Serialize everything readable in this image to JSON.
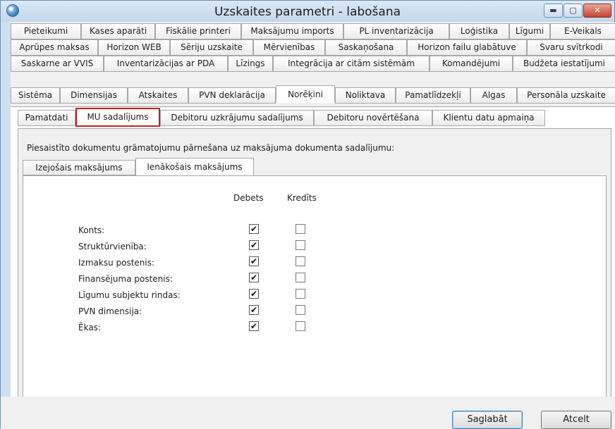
{
  "window": {
    "title": "Uzskaites parametri - labošana",
    "controls": {
      "minimize": "▬",
      "maximize": "▢",
      "close": "✕"
    }
  },
  "tabs": {
    "row1": [
      "Pieteikumi",
      "Kases aparāti",
      "Fiskālie printeri",
      "Maksājumu imports",
      "PL inventarizācija",
      "Loģistika",
      "Līgumi",
      "E-Veikals"
    ],
    "row2": [
      "Aprūpes maksas",
      "Horizon WEB",
      "Sēriju uzskaite",
      "Mērvienības",
      "Saskaņošana",
      "Horizon failu glabātuve",
      "Svaru svītrkodi"
    ],
    "row3": [
      "Saskarne ar VVIS",
      "Inventarizācijas ar PDA",
      "Līzings",
      "Integrācija ar citām sistēmām",
      "Komandējumi",
      "Budžeta iestatījumi"
    ],
    "row4": [
      "Sistēma",
      "Dimensijas",
      "Atskaites",
      "PVN deklarācija",
      "Norēķini",
      "Noliktava",
      "Pamatlīdzekļi",
      "Algas",
      "Personāla uzskaite"
    ],
    "active_row4_index": 4
  },
  "subtabs": {
    "items": [
      "Pamatdati",
      "MU sadalījums",
      "Debitoru uzkrājumu sadalījums",
      "Debitoru novērtēšana",
      "Klientu datu apmaiņa"
    ],
    "active_index": 1
  },
  "section": {
    "description": "Piesaistīto dokumentu grāmatojumu pārnešana uz maksājuma dokumenta sadalījumu:",
    "inner_tabs": [
      "Izejošais maksājums",
      "Ienākošais maksājums"
    ],
    "active_inner_index": 1,
    "columns": {
      "debit": "Debets",
      "credit": "Kredīts"
    },
    "rows": [
      {
        "label": "Konts:",
        "debit": true,
        "credit": false
      },
      {
        "label": "Struktūrvienība:",
        "debit": true,
        "credit": false
      },
      {
        "label": "Izmaksu postenis:",
        "debit": true,
        "credit": false
      },
      {
        "label": "Finansējuma postenis:",
        "debit": true,
        "credit": false
      },
      {
        "label": "Līgumu subjektu rindas:",
        "debit": true,
        "credit": false
      },
      {
        "label": "PVN dimensija:",
        "debit": true,
        "credit": false
      },
      {
        "label": "Ēkas:",
        "debit": true,
        "credit": false
      }
    ]
  },
  "buttons": {
    "save": "Saglabāt",
    "cancel": "Atcelt"
  },
  "colors": {
    "active_subtab_border": "#c42127",
    "title_bar": "#cfe0f3"
  }
}
